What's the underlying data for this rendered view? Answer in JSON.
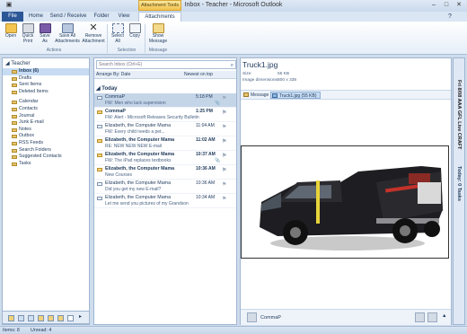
{
  "window": {
    "title": "Inbox - Teacher - Microsoft Outlook",
    "context_tab": "Attachment Tools"
  },
  "tabs": [
    "File",
    "Home",
    "Send / Receive",
    "Folder",
    "View",
    "Attachments"
  ],
  "ribbon": {
    "buttons": [
      "Open",
      "Quick Print",
      "Save As",
      "Save All Attachments",
      "Remove Attachment",
      "Select All",
      "Copy",
      "Show Message"
    ],
    "groups": [
      "Actions",
      "Selection",
      "Message"
    ]
  },
  "nav": {
    "account": "Teacher",
    "folders": [
      "Inbox (6)",
      "Drafts",
      "Sent Items",
      "Deleted Items"
    ],
    "other": [
      "Calendar",
      "Contacts",
      "Journal",
      "Junk E-mail",
      "Notes",
      "Outbox",
      "RSS Feeds",
      "Search Folders",
      "Suggested Contacts",
      "Tasks"
    ]
  },
  "list": {
    "search_placeholder": "Search Inbox (Ctrl+E)",
    "arrange_by": "Arrange By: Date",
    "sort": "Newest on top",
    "group": "Today",
    "messages": [
      {
        "sender": "CommaP",
        "time": "5:18 PM",
        "subject": "FW: Men who lack supervision",
        "unread": false,
        "attachment": true
      },
      {
        "sender": "CommaP",
        "time": "1:25 PM",
        "subject": "FW: Alert - Microsoft Releases Security Bulletin",
        "unread": true,
        "attachment": false
      },
      {
        "sender": "Elizabeth, the Computer Mama",
        "time": "11:04 AM",
        "subject": "FW: Every child needs a pet...",
        "unread": false,
        "attachment": false
      },
      {
        "sender": "Elizabeth, the Computer Mama",
        "time": "11:02 AM",
        "subject": "RE: NEW NEW NEW E-mail",
        "unread": true,
        "attachment": false
      },
      {
        "sender": "Elizabeth, the Computer Mama",
        "time": "10:37 AM",
        "subject": "FW: The iPad replaces textbooks",
        "unread": true,
        "attachment": true
      },
      {
        "sender": "Elizabeth, the Computer Mama",
        "time": "10:36 AM",
        "subject": "New Courses",
        "unread": true,
        "attachment": false
      },
      {
        "sender": "Elizabeth, the Computer Mama",
        "time": "10:36 AM",
        "subject": "Did you get my new E-mail?",
        "unread": false,
        "attachment": false
      },
      {
        "sender": "Elizabeth, the Computer Mama",
        "time": "10:34 AM",
        "subject": "Let me send you pictures of my Grandson",
        "unread": false,
        "attachment": false
      }
    ]
  },
  "reading": {
    "title": "Truck1.jpg",
    "size_label": "Size:",
    "size_value": "55 KB",
    "dim_label": "Image dimensions:",
    "dim_value": "600 x 338",
    "attachments": [
      "Message",
      "Truck1.jpg (55 KB)"
    ],
    "people": "CommaP"
  },
  "todo": {
    "items": [
      "Fri 8/08 AAA GFL Live CRAFT",
      "Today: 0 Tasks"
    ]
  },
  "status": {
    "items": "Items: 8",
    "unread": "Unread: 4"
  },
  "colors": {
    "accent": "#2b5797",
    "selection": "#c5d5e8",
    "context_tab": "#f2c34d"
  }
}
